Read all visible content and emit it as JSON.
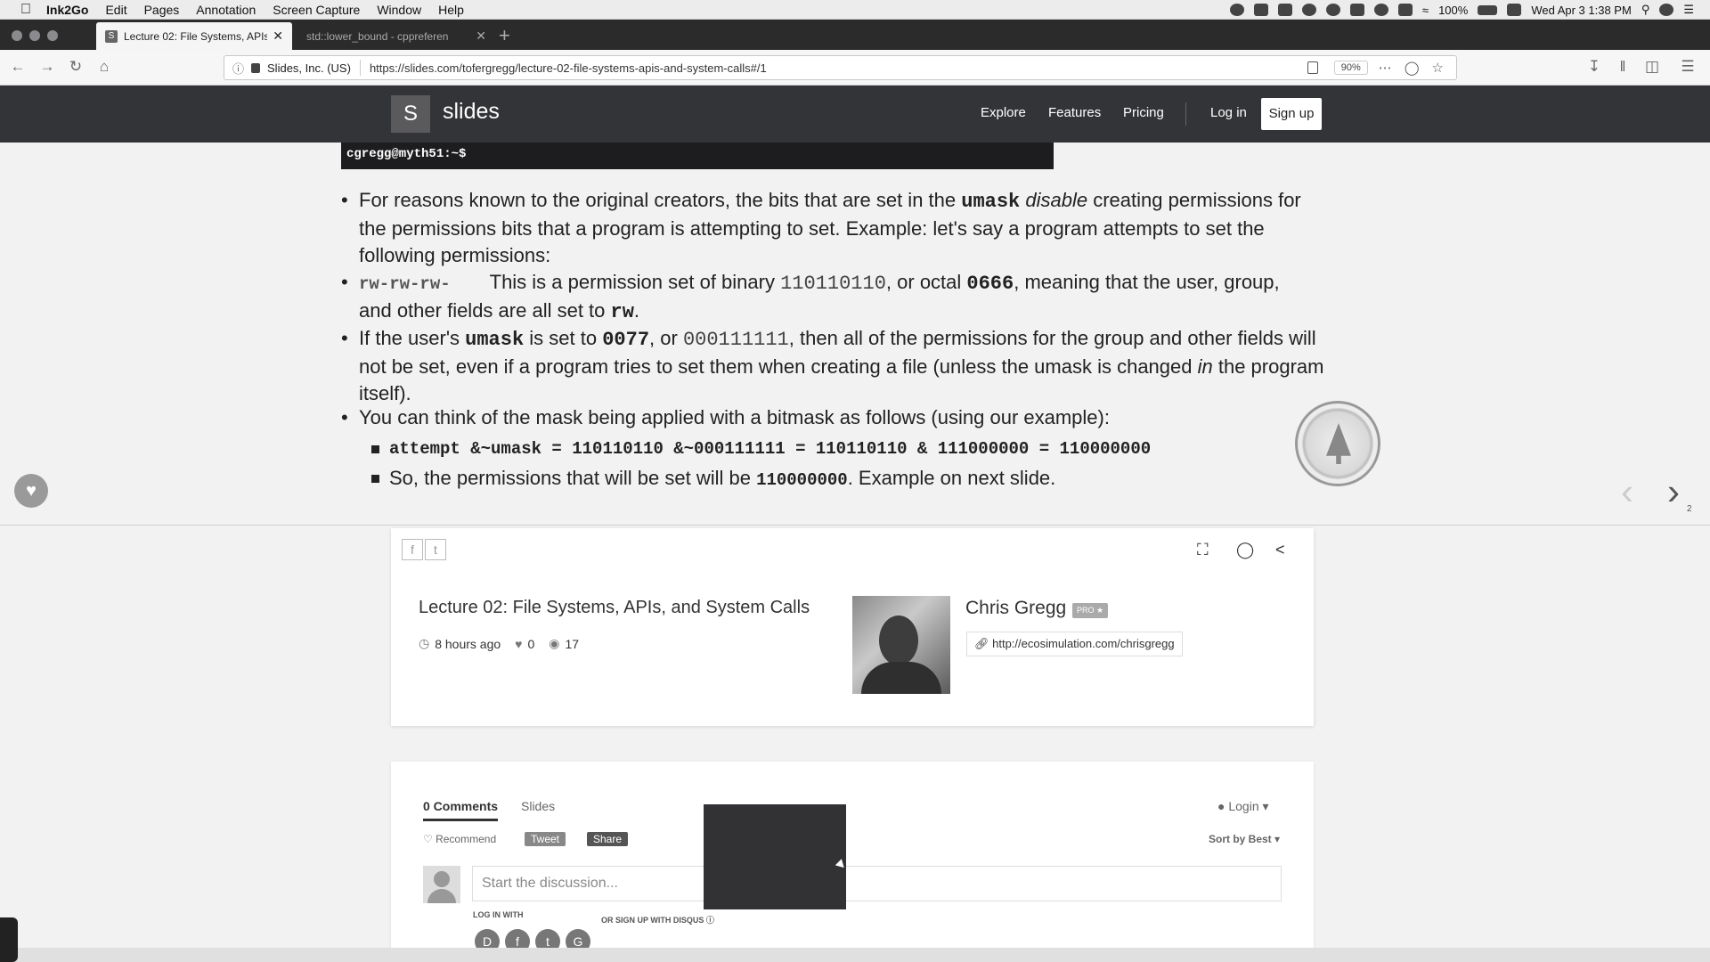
{
  "menubar": {
    "app": "Ink2Go",
    "items": [
      "Edit",
      "Pages",
      "Annotation",
      "Screen Capture",
      "Window",
      "Help"
    ],
    "battery": "100%",
    "datetime": "Wed Apr 3  1:38 PM"
  },
  "browser": {
    "tabs": [
      {
        "title": "Lecture 02: File Systems, APIs,",
        "favicon": "S"
      },
      {
        "title": "std::lower_bound - cppreferen"
      }
    ],
    "site_identity": "Slides, Inc. (US)",
    "url": "https://slides.com/tofergregg/lecture-02-file-systems-apis-and-system-calls#/1",
    "zoom": "90%"
  },
  "header": {
    "logo_letter": "S",
    "logo_text": "slides",
    "nav": [
      "Explore",
      "Features",
      "Pricing"
    ],
    "login": "Log in",
    "signup": "Sign up"
  },
  "slide": {
    "terminal_prompt": "cgregg@myth51:~$",
    "b1": {
      "t1": "For reasons known to the original creators, the bits that are set in the ",
      "code": "umask",
      "em": "disable",
      "t2": " creating permissions for",
      "line2": "the permissions bits that a program is attempting to set. Example: let's say a program attempts to set the",
      "line3": "following permissions:"
    },
    "b2": {
      "code": "rw-rw-rw-",
      "t1": "This is a permission set of binary ",
      "bin": "110110110",
      "t2": ", or octal ",
      "oct": "0666",
      "t3": ", meaning that the user, group,",
      "line2a": "and other fields are all set to ",
      "rw": "rw",
      "line2b": "."
    },
    "b3": {
      "t1": "If the user's ",
      "umask": "umask",
      "t2": " is set to ",
      "val": "0077",
      "t3": ", or ",
      "bin": "000111111",
      "t4": ", then all of the permissions for the group and other fields will",
      "line2a": "not be set, even if a program tries to set them when creating a file (unless the umask is changed ",
      "in": "in",
      "line2b": " the program",
      "line3": "itself)."
    },
    "b4": "You can think of the mask being applied with a bitmask as follows (using our example):",
    "sub1": "attempt &~umask = 110110110 &~000111111 = 110110110 & 111000000 = 110000000",
    "sub2": {
      "t1": "So, the permissions that will be set will be ",
      "val": "110000000",
      "t2": ". Example on next slide."
    },
    "slide_number": "2"
  },
  "deck": {
    "title": "Lecture 02: File Systems, APIs, and System Calls",
    "time": "8 hours ago",
    "likes": "0",
    "views": "17",
    "author": "Chris Gregg",
    "badge": "PRO ★",
    "link": "http://ecosimulation.com/chrisgregg"
  },
  "comments": {
    "tab_comments": "0 Comments",
    "tab_slides": "Slides",
    "login": "Login",
    "recommend": "Recommend",
    "tweet": "Tweet",
    "share": "Share",
    "sort": "Sort by Best",
    "placeholder": "Start the discussion...",
    "login_with": "LOG IN WITH",
    "or_signup": "OR SIGN UP WITH DISQUS",
    "social": [
      "D",
      "f",
      "t",
      "G"
    ]
  }
}
